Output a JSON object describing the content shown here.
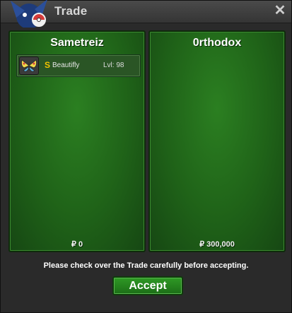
{
  "window": {
    "title": "Trade",
    "close_label": "✕"
  },
  "trade": {
    "left": {
      "player_name": "Sametreiz",
      "money": "₽ 0",
      "items": [
        {
          "icon": "beautifly-sprite-icon",
          "shiny_badge": "S",
          "name": "Beautifly",
          "level": "Lvl: 98"
        }
      ]
    },
    "right": {
      "player_name": "0rthodox",
      "money": "₽ 300,000",
      "items": []
    }
  },
  "footer": {
    "notice": "Please check over the Trade carefully before accepting.",
    "accept_label": "Accept"
  },
  "colors": {
    "panel_green": "#1f6218",
    "title_text": "#d8d8d8",
    "shiny_gold": "#f2c200"
  }
}
